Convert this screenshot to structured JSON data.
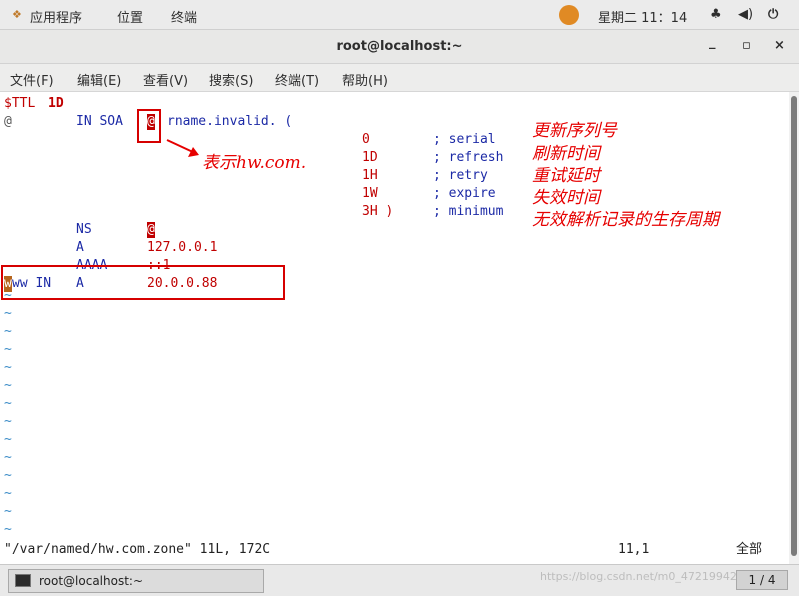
{
  "topbar": {
    "apps": "应用程序",
    "places": "位置",
    "terminal": "终端",
    "clock": "星期二 11：14"
  },
  "window": {
    "title": "root@localhost:~",
    "minimize": "_",
    "maximize": "▫",
    "close": "×"
  },
  "menu": [
    "文件(F)",
    "编辑(E)",
    "查看(V)",
    "搜索(S)",
    "终端(T)",
    "帮助(H)"
  ],
  "editor": {
    "l1_ttl": "$TTL",
    "l1_val": "1D",
    "l2_at": "@",
    "l2_in_soa": "IN SOA",
    "l2_at2": "@",
    "l2_rname": "rname.invalid. (",
    "serial_val": "0",
    "serial_cmt": "; serial",
    "refresh_val": "1D",
    "refresh_cmt": "; refresh",
    "retry_val": "1H",
    "retry_cmt": "; retry",
    "expire_val": "1W",
    "expire_cmt": "; expire",
    "min_val": "3H )",
    "min_cmt": "; minimum",
    "ns": "NS",
    "ns_val": "@",
    "a": "A",
    "a_val": "127.0.0.1",
    "aaaa": "AAAA",
    "aaaa_val": "::1",
    "www_cursor": "w",
    "www_rest": "ww IN",
    "www_a": "A",
    "www_val": "20.0.0.88",
    "tilde": "~",
    "status_file": "\"/var/named/hw.com.zone\" 11L, 172C",
    "status_pos": "11,1",
    "status_all": "全部"
  },
  "annotations": {
    "at_means": "表示hw.com.",
    "serial": "更新序列号",
    "refresh": "刷新时间",
    "retry": "重试延时",
    "expire": "失效时间",
    "minimum": "无效解析记录的生存周期"
  },
  "taskbar": {
    "item": "root@localhost:~",
    "pager": "1 / 4",
    "watermark": "https://blog.csdn.net/m0_47219942"
  }
}
